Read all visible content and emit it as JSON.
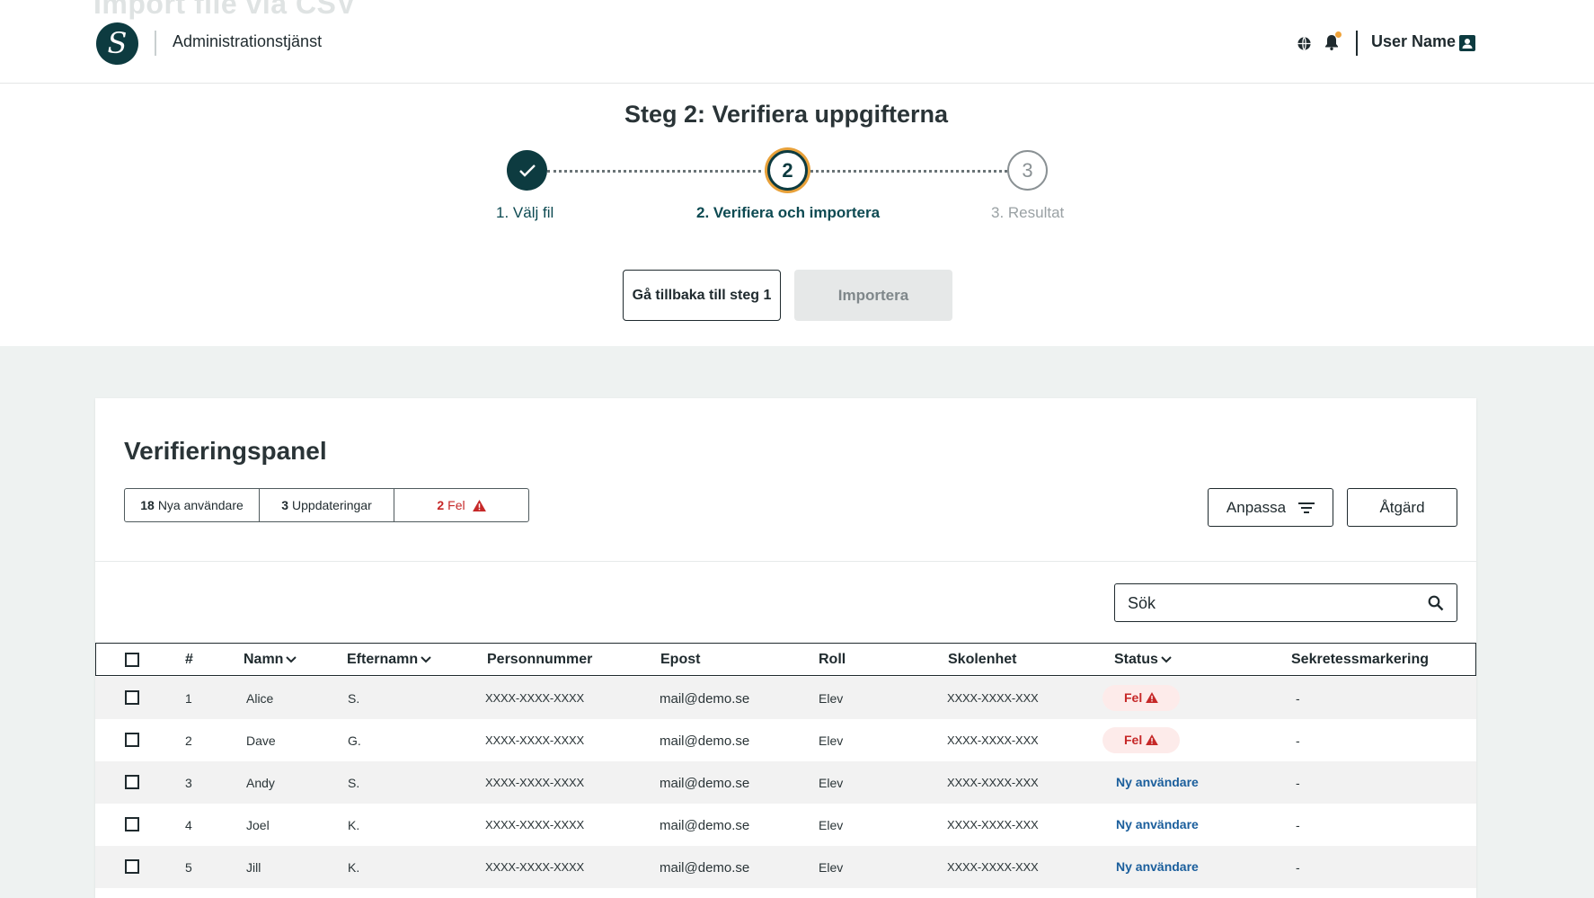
{
  "header": {
    "ghost_title": "Import file via CSV",
    "logo_letter": "S",
    "app_title": "Administrationstjänst",
    "user_name": "User Name",
    "notification_dot_color": "#f0a33a"
  },
  "stepper": {
    "title": "Steg 2: Verifiera uppgifterna",
    "steps": [
      {
        "number": "✓",
        "label": "1. Välj fil",
        "state": "done"
      },
      {
        "number": "2",
        "label": "2. Verifiera och importera",
        "state": "current"
      },
      {
        "number": "3",
        "label": "3. Resultat",
        "state": "upcoming"
      }
    ],
    "back_button": "Gå tillbaka till steg 1",
    "import_button": "Importera"
  },
  "panel": {
    "title": "Verifieringspanel",
    "summary": [
      {
        "count": "18",
        "label": "Nya användare"
      },
      {
        "count": "3",
        "label": "Uppdateringar"
      },
      {
        "count": "2",
        "label": "Fel"
      }
    ],
    "customize_button": "Anpassa",
    "action_button": "Åtgärd",
    "search_placeholder": "Sök"
  },
  "table": {
    "columns": [
      "#",
      "Namn",
      "Efternamn",
      "Personnummer",
      "Epost",
      "Roll",
      "Skolenhet",
      "Status",
      "Sekretessmarkering"
    ],
    "rows": [
      {
        "num": "1",
        "name": "Alice",
        "surname": "S.",
        "pnr": "XXXX-XXXX-XXXX",
        "email": "mail@demo.se",
        "role": "Elev",
        "unit": "XXXX-XXXX-XXX",
        "status": "Fel",
        "secret": "-"
      },
      {
        "num": "2",
        "name": "Dave",
        "surname": "G.",
        "pnr": "XXXX-XXXX-XXXX",
        "email": "mail@demo.se",
        "role": "Elev",
        "unit": "XXXX-XXXX-XXX",
        "status": "Fel",
        "secret": "-"
      },
      {
        "num": "3",
        "name": "Andy",
        "surname": "S.",
        "pnr": "XXXX-XXXX-XXXX",
        "email": "mail@demo.se",
        "role": "Elev",
        "unit": "XXXX-XXXX-XXX",
        "status": "Ny användare",
        "secret": "-"
      },
      {
        "num": "4",
        "name": "Joel",
        "surname": "K.",
        "pnr": "XXXX-XXXX-XXXX",
        "email": "mail@demo.se",
        "role": "Elev",
        "unit": "XXXX-XXXX-XXX",
        "status": "Ny användare",
        "secret": "-"
      },
      {
        "num": "5",
        "name": "Jill",
        "surname": "K.",
        "pnr": "XXXX-XXXX-XXXX",
        "email": "mail@demo.se",
        "role": "Elev",
        "unit": "XXXX-XXXX-XXX",
        "status": "Ny användare",
        "secret": "-"
      }
    ]
  },
  "colors": {
    "brand": "#0d3b40",
    "accent": "#e8a13a",
    "error": "#c62828",
    "link": "#1a5e9c"
  }
}
